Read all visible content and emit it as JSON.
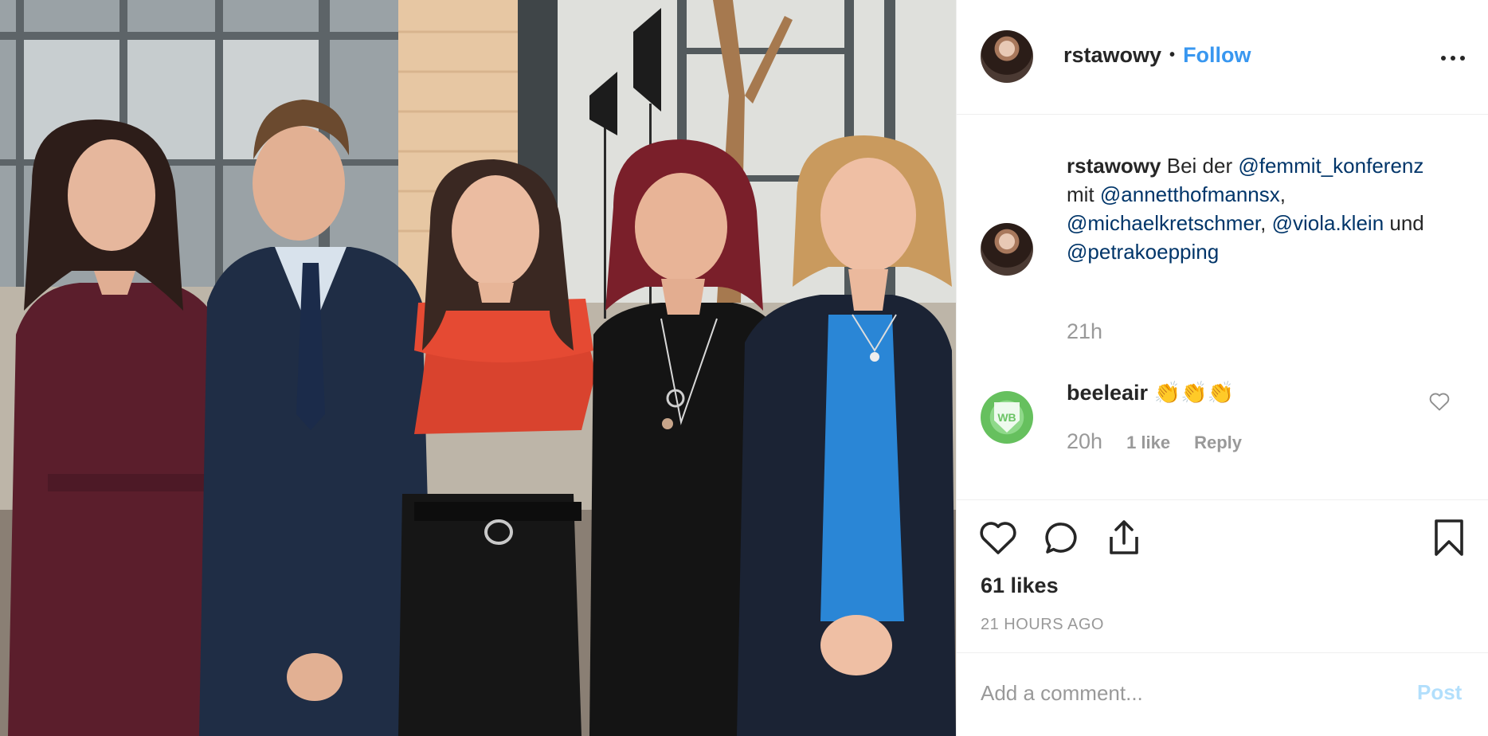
{
  "post": {
    "username": "rstawowy",
    "separator": "•",
    "follow_label": "Follow",
    "more_icon": "more-options-icon"
  },
  "caption": {
    "username": "rstawowy",
    "text_1": " Bei der ",
    "mention_1": "@femmit_konferenz",
    "text_2": " mit ",
    "mention_2": "@annetthofmannsx",
    "text_3": ", ",
    "mention_3": "@michaelkretschmer",
    "text_4": ", ",
    "mention_4": "@viola.klein",
    "text_5": " und ",
    "mention_5": "@petrakoepping",
    "time": "21h"
  },
  "comment": {
    "username": "beeleair",
    "text": " 👏👏👏",
    "time": "20h",
    "likes": "1 like",
    "reply_label": "Reply",
    "avatar_text": "WB"
  },
  "actions": {
    "likes": "61 likes",
    "time_ago": "21 HOURS AGO",
    "icons": [
      "heart-icon",
      "comment-icon",
      "share-icon",
      "bookmark-icon"
    ]
  },
  "add_comment": {
    "placeholder": "Add a comment...",
    "post_label": "Post"
  },
  "colors": {
    "link": "#3897f0",
    "mention": "#003569",
    "muted": "#999999",
    "post_disabled": "#b2dffc"
  }
}
